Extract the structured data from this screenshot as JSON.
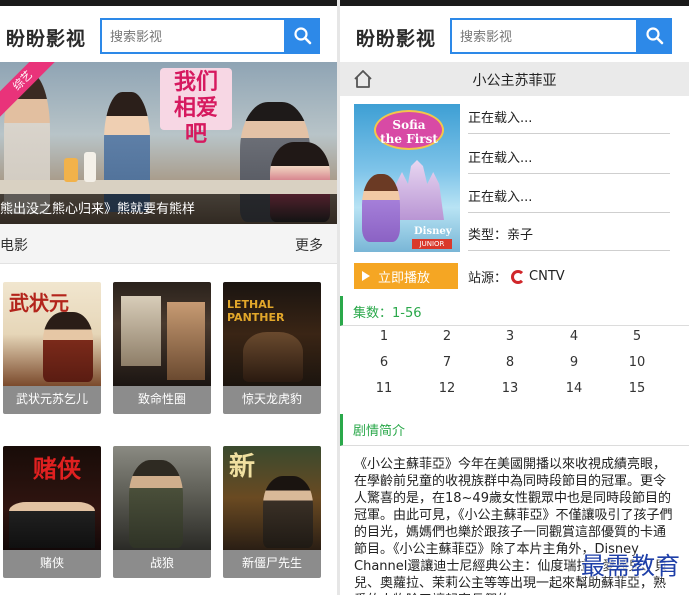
{
  "left": {
    "brand": "盼盼影视",
    "search": {
      "placeholder": "搜索影视"
    },
    "banner": {
      "caption": "熊出没之熊心归来》熊就要有熊样",
      "sign_text": "我们相爱吧",
      "corner_badge": "综艺"
    },
    "section": {
      "title": "电影",
      "more": "更多"
    },
    "movies": [
      {
        "title": "武状元苏乞儿",
        "logo": "武状元",
        "logo_color": "#b3241b"
      },
      {
        "title": "致命性圈",
        "logo": "",
        "logo_color": "#e9e0cf"
      },
      {
        "title": "惊天龙虎豹",
        "logo": "LETHAL PANTHER",
        "logo_color": "#e2a72a"
      },
      {
        "title": "赌侠",
        "logo": "赌侠",
        "logo_color": "#e02020"
      },
      {
        "title": "战狼",
        "logo": "",
        "logo_color": "#cfcfcf"
      },
      {
        "title": "新僵尸先生",
        "logo": "新",
        "logo_color": "#f0e0a0"
      }
    ]
  },
  "right": {
    "brand": "盼盼影视",
    "search": {
      "placeholder": "搜索影视"
    },
    "title": "小公主苏菲亚",
    "cover": {
      "logo_text": "Sofia the First",
      "brand": "Disney",
      "badge": "JUNIOR"
    },
    "info": {
      "loading_1": "正在载入...",
      "loading_2": "正在载入...",
      "loading_3": "正在载入...",
      "genre": "类型：亲子"
    },
    "play_label": "立即播放",
    "source_label": "站源：",
    "source_name": "CNTV",
    "episodes_header": "集数：1-56",
    "episodes": [
      "1",
      "2",
      "3",
      "4",
      "5",
      "6",
      "7",
      "8",
      "9",
      "10",
      "11",
      "12",
      "13",
      "14",
      "15"
    ],
    "synopsis_header": "剧情简介",
    "synopsis": "《小公主蘇菲亞》今年在美國開播以來收視成績亮眼，在學齡前兒童的收視族群中為同時段節目的冠軍。更令人驚喜的是，在18~49歲女性觀眾中也是同時段節目的冠軍。由此可見，《小公主蘇菲亞》不僅讓吸引了孩子們的目光，媽媽們也樂於跟孩子一同觀賞這部優質的卡通節目。《小公主蘇菲亞》除了本片主角外，Disney Channel還讓迪士尼經典公主：仙度瑞拉、愛麗兒、貝兒、奧蘿拉、茉莉公主等等出現一起來幫助蘇菲亞，熟悉的人物除了讓起家長們的",
    "watermark": "最需教育"
  },
  "colors": {
    "accent": "#2d89e8",
    "play": "#f5a623",
    "section_green": "#2aa84a"
  }
}
